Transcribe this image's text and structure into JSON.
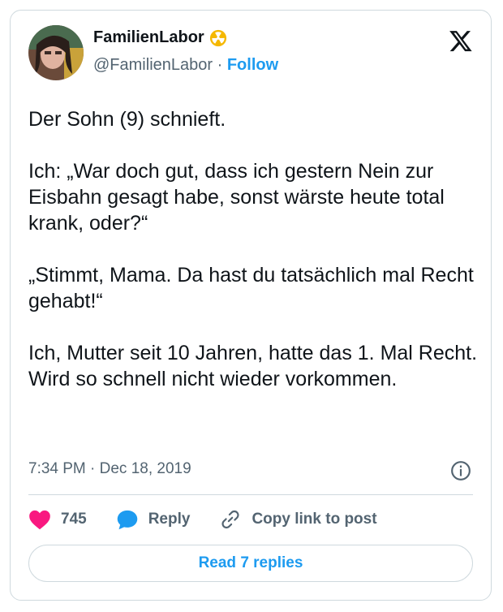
{
  "author": {
    "name": "FamilienLabor",
    "handle": "@FamilienLabor",
    "separator": "·",
    "follow_label": "Follow",
    "badge_icon": "radioactive-icon"
  },
  "tweet": {
    "text": "Der Sohn (9) schnieft.\n\nIch: „War doch gut, dass ich gestern Nein zur Eisbahn gesagt habe, sonst wärste heute total krank, oder?“\n\n„Stimmt, Mama. Da hast du tatsächlich mal Recht gehabt!“\n\nIch, Mutter seit 10 Jahren, hatte das 1. Mal Recht. Wird so schnell nicht wieder vorkommen.",
    "timestamp": "7:34 PM · Dec 18, 2019"
  },
  "actions": {
    "like_count": "745",
    "reply_label": "Reply",
    "copy_link_label": "Copy link to post"
  },
  "footer": {
    "read_replies_label": "Read 7 replies"
  },
  "colors": {
    "accent": "#1d9bf0",
    "like": "#f91880",
    "text": "#0f1419",
    "muted": "#536471",
    "border": "#cfd9de"
  }
}
